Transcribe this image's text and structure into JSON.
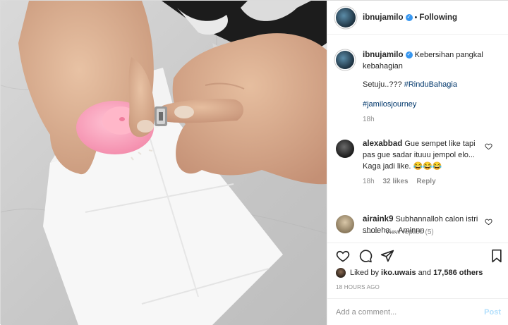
{
  "post": {
    "username": "ibnujamilo",
    "following_label": "Following",
    "caption_line1": "Kebersihan pangkal kebahagian",
    "caption_line2_text": "Setuju..??? ",
    "caption_hashtag1": "#RinduBahagia",
    "caption_hashtag2": "#jamilosjourney",
    "caption_age": "18h",
    "verified_glyph": "✓"
  },
  "comments": [
    {
      "username": "alexabbad",
      "text": "Gue sempet like tapi pas gue sadar ituuu jempol elo... Kaga jadi like. 😂😂😂",
      "age": "18h",
      "likes": "32 likes",
      "reply_label": "Reply",
      "view_replies": "View replies (5)"
    },
    {
      "username": "airaink9",
      "text": "Subhannalloh calon istri sholeha... Aminnn"
    }
  ],
  "likes": {
    "prefix": "Liked by ",
    "user": "iko.uwais",
    "middle": " and ",
    "count": "17,586 others"
  },
  "timestamp": "18 HOURS AGO",
  "add_comment": {
    "placeholder": "Add a comment...",
    "post_label": "Post"
  },
  "icons": {
    "like": "heart-icon",
    "comment": "comment-icon",
    "share": "paper-plane-icon",
    "save": "bookmark-icon",
    "verified": "verified-badge-icon"
  },
  "colors": {
    "link": "#00376b",
    "verified": "#3897f0",
    "muted": "#8e8e8e",
    "post_disabled": "#b2dffc"
  }
}
